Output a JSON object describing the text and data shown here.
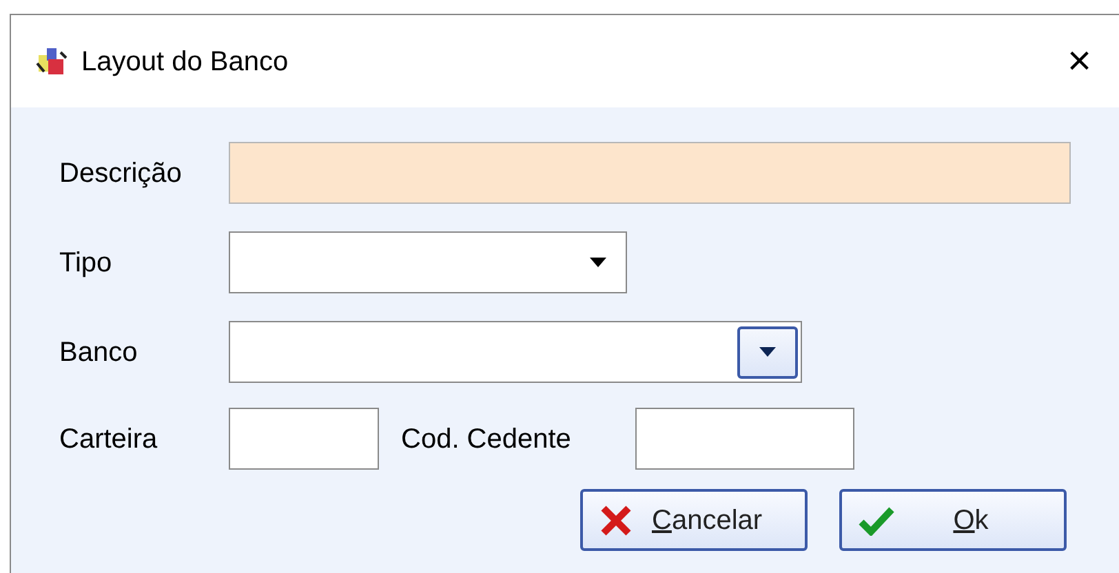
{
  "window": {
    "title": "Layout do Banco",
    "close": "×"
  },
  "fields": [
    {
      "label": "Descrição",
      "kind": "text",
      "required": true
    },
    {
      "label": "Tipo",
      "kind": "select"
    },
    {
      "label": "Banco",
      "kind": "lookup"
    }
  ],
  "carteira": {
    "label": "Carteira"
  },
  "cod_cedente": {
    "label": "Cod. Cedente"
  },
  "buttons": [
    {
      "label": "Cancelar",
      "kind": "cancel",
      "underline_first": true
    },
    {
      "label": "Ok",
      "kind": "ok",
      "underline_first": true
    }
  ]
}
